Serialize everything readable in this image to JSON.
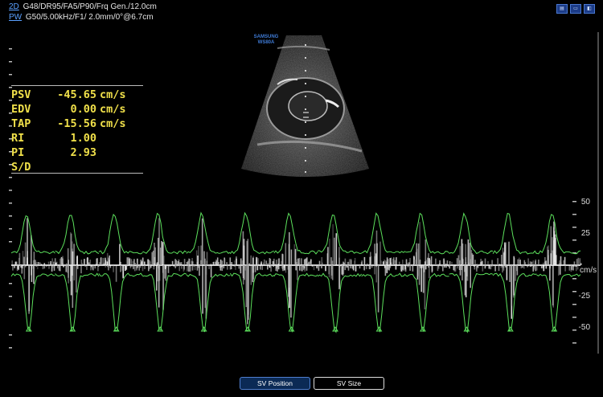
{
  "header": {
    "line1_mode": "2D",
    "line1_params": "G48/DR95/FA5/P90/Frq Gen./12.0cm",
    "line2_mode": "PW",
    "line2_params": "G50/5.00kHz/F1/ 2.0mm/0°@6.7cm"
  },
  "brand": {
    "line1": "SAMSUNG",
    "line2": "WS80A"
  },
  "measurements": [
    {
      "label": "PSV",
      "value": "-45.65",
      "unit": "cm/s"
    },
    {
      "label": "EDV",
      "value": "0.00",
      "unit": "cm/s"
    },
    {
      "label": "TAP",
      "value": "-15.56",
      "unit": "cm/s"
    },
    {
      "label": "RI",
      "value": "1.00",
      "unit": ""
    },
    {
      "label": "PI",
      "value": "2.93",
      "unit": ""
    },
    {
      "label": "S/D",
      "value": "",
      "unit": ""
    }
  ],
  "scale": {
    "unit": "cm/s",
    "ticks": [
      {
        "label": "50",
        "value": 50
      },
      {
        "label": "25",
        "value": 25
      },
      {
        "label": "-25",
        "value": -25
      },
      {
        "label": "-50",
        "value": -50
      }
    ]
  },
  "buttons": {
    "sv_position": "SV Position",
    "sv_size": "SV Size"
  },
  "colors": {
    "measurement_text": "#f0e04a",
    "envelope": "#5ce05c",
    "button_active_bg": "#0b2a55"
  }
}
